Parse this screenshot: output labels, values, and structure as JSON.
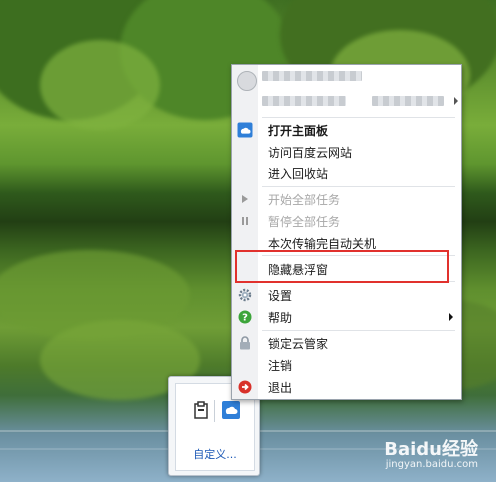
{
  "menu": {
    "items": [
      {
        "label": "打开主面板"
      },
      {
        "label": "访问百度云网站"
      },
      {
        "label": "进入回收站"
      },
      {
        "label": "开始全部任务"
      },
      {
        "label": "暂停全部任务"
      },
      {
        "label": "本次传输完自动关机"
      },
      {
        "label": "隐藏悬浮窗"
      },
      {
        "label": "设置"
      },
      {
        "label": "帮助"
      },
      {
        "label": "锁定云管家"
      },
      {
        "label": "注销"
      },
      {
        "label": "退出"
      }
    ],
    "highlight_color": "#e1312d",
    "cloud_icon_color": "#2f7fd8"
  },
  "tray": {
    "custom_label": "自定义..."
  },
  "watermark": {
    "logo": "Baidu经验",
    "url": "jingyan.baidu.com"
  }
}
